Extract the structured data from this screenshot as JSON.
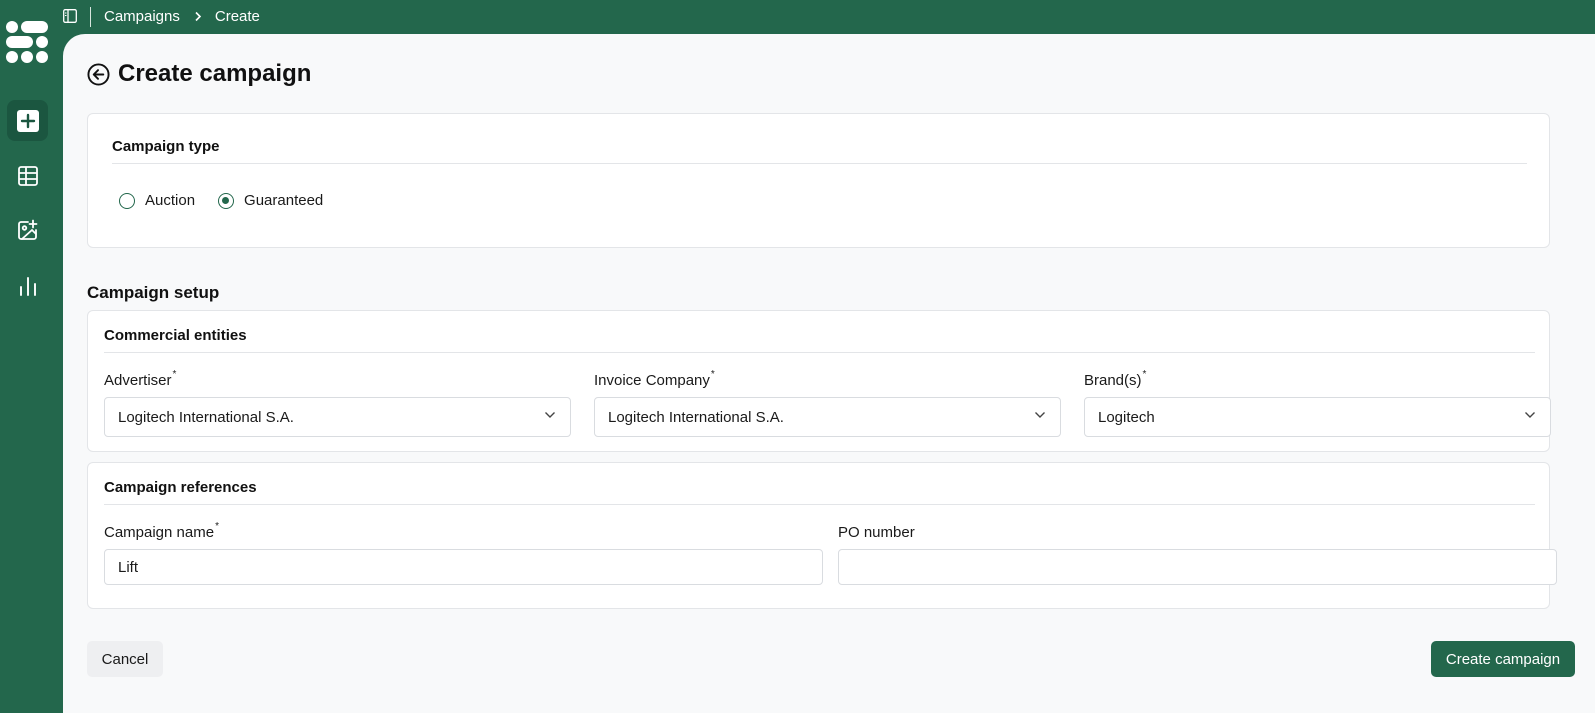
{
  "colors": {
    "brand": "#23674c",
    "background": "#f8f9fa",
    "border": "#e3e5e8"
  },
  "sidebar": {
    "items": [
      {
        "icon": "plus-square-icon",
        "active": true
      },
      {
        "icon": "table-icon",
        "active": false
      },
      {
        "icon": "image-plus-icon",
        "active": false
      },
      {
        "icon": "bar-chart-icon",
        "active": false
      }
    ]
  },
  "breadcrumb": {
    "items": [
      "Campaigns",
      "Create"
    ]
  },
  "page": {
    "title": "Create campaign"
  },
  "campaign_type": {
    "title": "Campaign type",
    "options": [
      "Auction",
      "Guaranteed"
    ],
    "selected": "Guaranteed"
  },
  "setup": {
    "title": "Campaign setup"
  },
  "commercial": {
    "title": "Commercial entities",
    "advertiser": {
      "label": "Advertiser",
      "value": "Logitech International S.A."
    },
    "invoice": {
      "label": "Invoice Company",
      "value": "Logitech International S.A."
    },
    "brands": {
      "label": "Brand(s)",
      "value": "Logitech"
    }
  },
  "references": {
    "title": "Campaign references",
    "name": {
      "label": "Campaign name",
      "value": "Lift"
    },
    "po": {
      "label": "PO number",
      "value": ""
    }
  },
  "actions": {
    "cancel": "Cancel",
    "submit": "Create campaign"
  },
  "required_mark": "*"
}
